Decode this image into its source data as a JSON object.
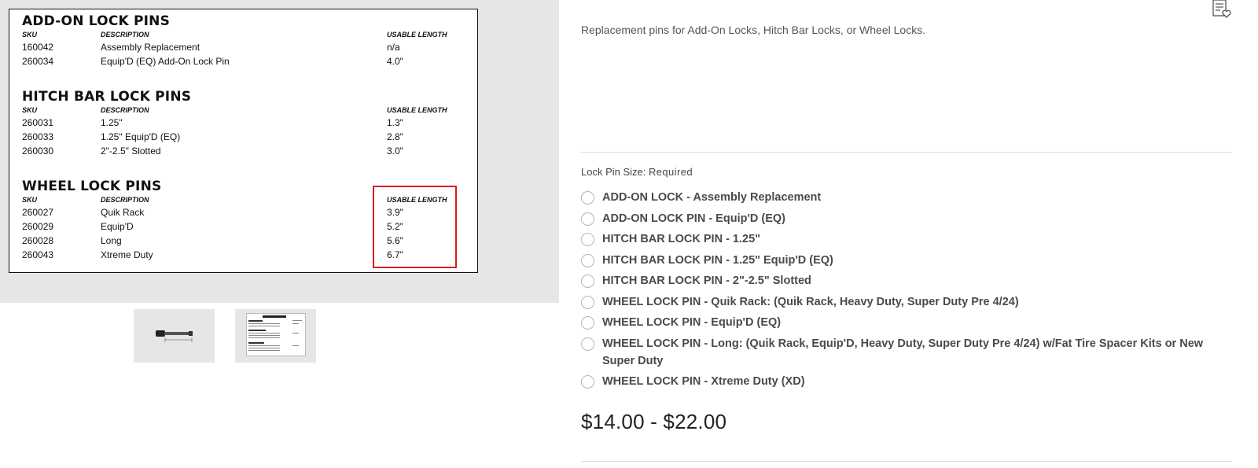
{
  "spec_card": {
    "sections": [
      {
        "title": "ADD-ON LOCK PINS",
        "headers": {
          "sku": "SKU",
          "description": "DESCRIPTION",
          "length": "USABLE LENGTH"
        },
        "rows": [
          {
            "sku": "160042",
            "description": "Assembly Replacement",
            "length": "n/a"
          },
          {
            "sku": "260034",
            "description": "Equip'D (EQ) Add-On Lock Pin",
            "length": "4.0\""
          }
        ]
      },
      {
        "title": "HITCH BAR LOCK PINS",
        "headers": {
          "sku": "SKU",
          "description": "DESCRIPTION",
          "length": "USABLE LENGTH"
        },
        "rows": [
          {
            "sku": "260031",
            "description": "1.25\"",
            "length": "1.3\""
          },
          {
            "sku": "260033",
            "description": "1.25\" Equip'D (EQ)",
            "length": "2.8\""
          },
          {
            "sku": "260030",
            "description": "2\"-2.5\" Slotted",
            "length": "3.0\""
          }
        ]
      },
      {
        "title": "WHEEL LOCK PINS",
        "headers": {
          "sku": "SKU",
          "description": "DESCRIPTION",
          "length": "USABLE LENGTH"
        },
        "rows": [
          {
            "sku": "260027",
            "description": "Quik Rack",
            "length": "3.9\""
          },
          {
            "sku": "260029",
            "description": "Equip'D",
            "length": "5.2\""
          },
          {
            "sku": "260028",
            "description": "Long",
            "length": "5.6\""
          },
          {
            "sku": "260043",
            "description": "Xtreme Duty",
            "length": "6.7\""
          }
        ]
      }
    ],
    "highlight_color": "#e01b1b"
  },
  "thumbnails": [
    {
      "icon": "lock-pin-image"
    },
    {
      "icon": "spec-sheet-image"
    }
  ],
  "product": {
    "description": "Replacement pins for Add-On Locks, Hitch Bar Locks, or Wheel Locks.",
    "wishlist_icon": "wishlist-icon",
    "option_label": "Lock Pin Size:",
    "option_required": "Required",
    "options": [
      "ADD-ON LOCK - Assembly Replacement",
      "ADD-ON LOCK PIN - Equip'D (EQ)",
      "HITCH BAR LOCK PIN - 1.25\"",
      "HITCH BAR LOCK PIN - 1.25\" Equip'D (EQ)",
      "HITCH BAR LOCK PIN - 2\"-2.5\" Slotted",
      "WHEEL LOCK PIN - Quik Rack: (Quik Rack, Heavy Duty, Super Duty Pre 4/24)",
      "WHEEL LOCK PIN - Equip'D (EQ)",
      "WHEEL LOCK PIN - Long: (Quik Rack, Equip'D, Heavy Duty, Super Duty Pre 4/24) w/Fat Tire Spacer Kits or New Super Duty",
      "WHEEL LOCK PIN - Xtreme Duty (XD)"
    ],
    "price": "$14.00 - $22.00"
  }
}
